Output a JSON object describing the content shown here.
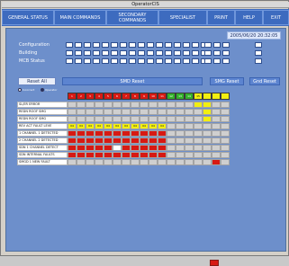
{
  "window": {
    "title": "OperatorCIS"
  },
  "nav": {
    "items": [
      {
        "label": "GENERAL STATUS"
      },
      {
        "label": "MAIN COMMANDS"
      },
      {
        "label": "SECONDARY\nCOMMANDS"
      },
      {
        "label": "SPECIALIST"
      },
      {
        "label": "PRINT"
      },
      {
        "label": "HELP"
      },
      {
        "label": "EXIT"
      }
    ]
  },
  "header": {
    "timestamp": "2005/06/20 20:32:05"
  },
  "status": {
    "configuration_label": "Configuration",
    "building_label": "Building",
    "mcb_status_label": "MCB Status"
  },
  "actions": {
    "reset_all": "Reset All",
    "smd_reset": "SMD Reset",
    "smg_reset": "SMG Reset",
    "gnd_reset": "Gnd Reset"
  },
  "filters": {
    "left": "Incorrect",
    "right": "Operator"
  },
  "grid": {
    "rows": [
      "SL/ER ERROR",
      "REDN ROOF SMG",
      "REDN ROOF SMG",
      "REV ACT FAULT LEVE",
      "1 CHANNEL 1 DETECTED",
      "2 CHANNEL 2 DETECTED",
      "SDN 1 CHANNEL DETECT",
      "SDN INTERNAL FAULTS",
      "SMGD 1 NEW FAULT"
    ],
    "top_labels": [
      "1",
      "2",
      "3",
      "4",
      "5",
      "6",
      "7",
      "8",
      "9",
      "10",
      "11",
      "12",
      "13",
      "14",
      "15"
    ],
    "status_values": [
      "04",
      "04",
      "04",
      "04",
      "04",
      "04",
      "04",
      "04",
      "04",
      "04",
      "04"
    ]
  }
}
